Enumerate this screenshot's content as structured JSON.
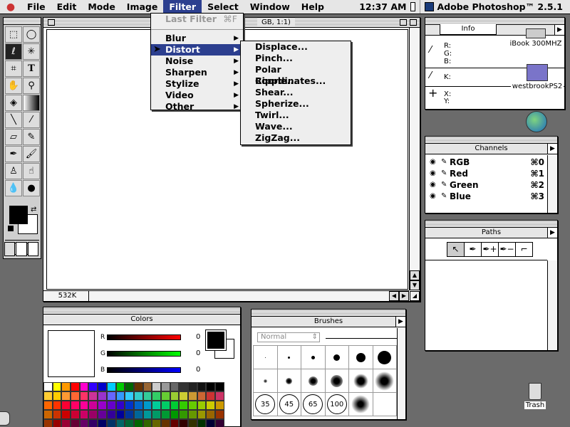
{
  "menubar": {
    "items": [
      "File",
      "Edit",
      "Mode",
      "Image",
      "Filter",
      "Select",
      "Window",
      "Help"
    ],
    "active": "Filter",
    "clock": "12:37 AM",
    "app_name": "Adobe Photoshop™ 2.5.1"
  },
  "document": {
    "title_fragment": "GB, 1:1)",
    "size_readout": "532K"
  },
  "filter_menu": {
    "last_filter": "Last Filter",
    "last_filter_key": "⌘F",
    "items": [
      "Blur",
      "Distort",
      "Noise",
      "Sharpen",
      "Stylize",
      "Video",
      "Other"
    ],
    "highlighted": "Distort"
  },
  "distort_menu": {
    "items": [
      "Displace...",
      "Pinch...",
      "Polar Coordinates...",
      "Ripple...",
      "Shear...",
      "Spherize...",
      "Twirl...",
      "Wave...",
      "ZigZag..."
    ]
  },
  "info": {
    "title": "Info",
    "rgb_labels": [
      "R:",
      "G:",
      "B:"
    ],
    "k_label": "K:",
    "xy_labels": [
      "X:",
      "Y:"
    ]
  },
  "channels": {
    "title": "Channels",
    "rows": [
      {
        "name": "RGB",
        "key": "⌘0"
      },
      {
        "name": "Red",
        "key": "⌘1"
      },
      {
        "name": "Green",
        "key": "⌘2"
      },
      {
        "name": "Blue",
        "key": "⌘3"
      }
    ]
  },
  "paths": {
    "title": "Paths"
  },
  "colors": {
    "title": "Colors",
    "labels": [
      "R",
      "G",
      "B"
    ],
    "values": [
      "0",
      "0",
      "0"
    ]
  },
  "brushes": {
    "title": "Brushes",
    "mode": "Normal",
    "size_labels": [
      "35",
      "45",
      "65",
      "100"
    ]
  },
  "desktop": {
    "icons": [
      "iBook 300MHZ",
      "westbrookPS2",
      "Trash"
    ]
  }
}
